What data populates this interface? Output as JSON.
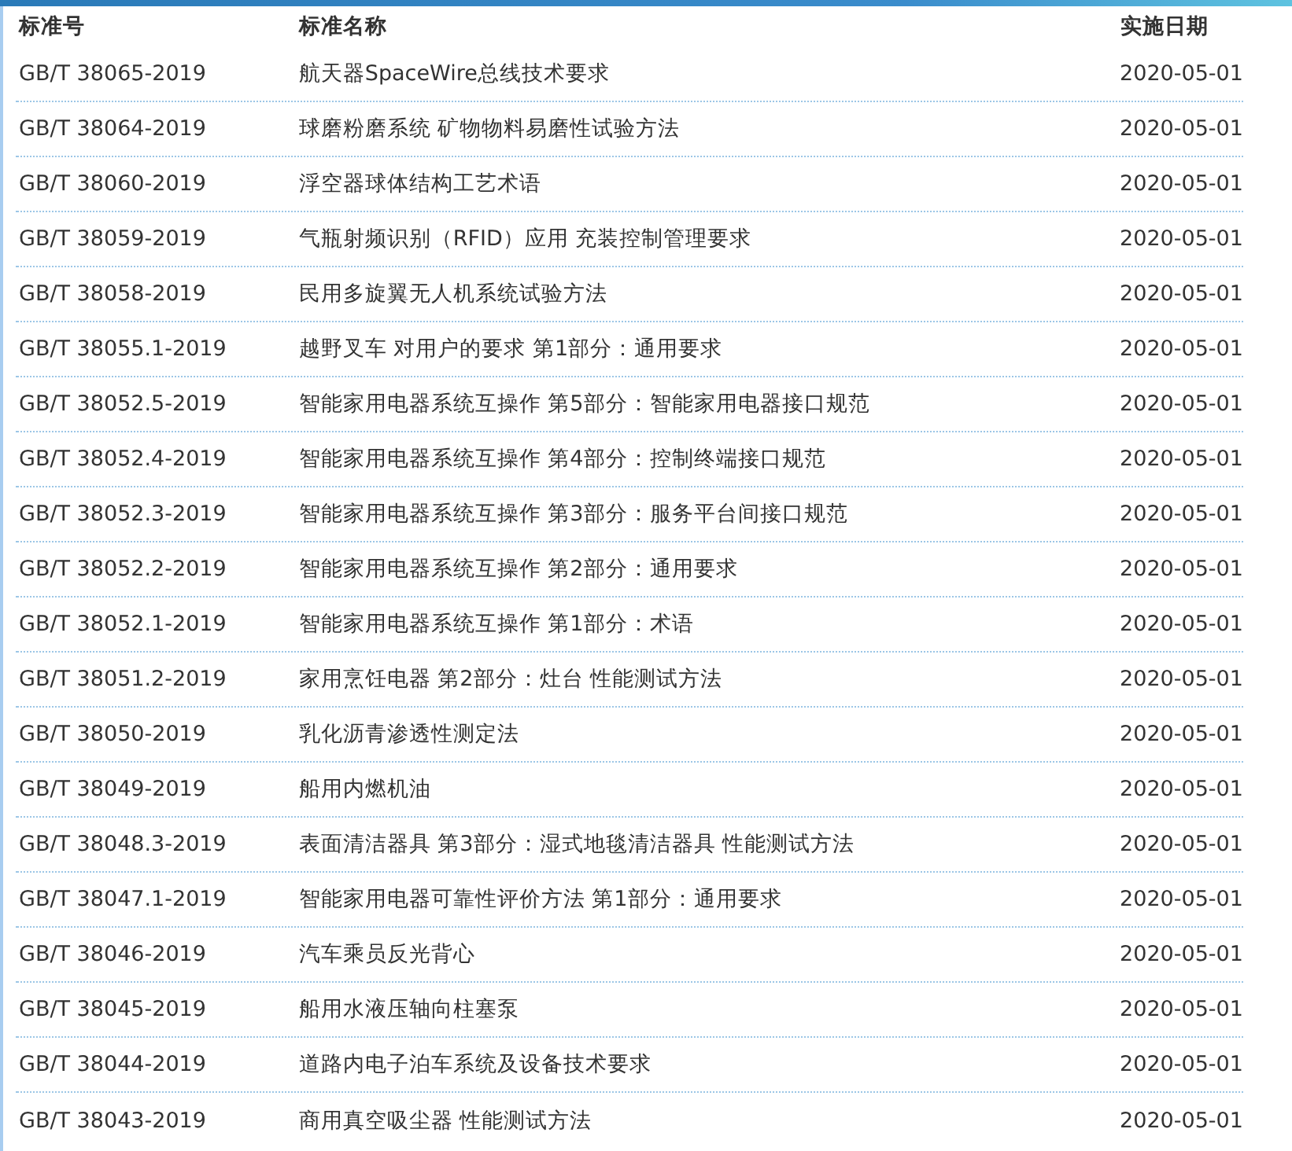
{
  "table": {
    "columns": [
      "标准号",
      "标准名称",
      "实施日期"
    ],
    "rows": [
      [
        "GB/T 38065-2019",
        "航天器SpaceWire总线技术要求",
        "2020-05-01"
      ],
      [
        "GB/T 38064-2019",
        "球磨粉磨系统 矿物物料易磨性试验方法",
        "2020-05-01"
      ],
      [
        "GB/T 38060-2019",
        "浮空器球体结构工艺术语",
        "2020-05-01"
      ],
      [
        "GB/T 38059-2019",
        "气瓶射频识别（RFID）应用 充装控制管理要求",
        "2020-05-01"
      ],
      [
        "GB/T 38058-2019",
        "民用多旋翼无人机系统试验方法",
        "2020-05-01"
      ],
      [
        "GB/T 38055.1-2019",
        "越野叉车 对用户的要求 第1部分：通用要求",
        "2020-05-01"
      ],
      [
        "GB/T 38052.5-2019",
        "智能家用电器系统互操作 第5部分：智能家用电器接口规范",
        "2020-05-01"
      ],
      [
        "GB/T 38052.4-2019",
        "智能家用电器系统互操作 第4部分：控制终端接口规范",
        "2020-05-01"
      ],
      [
        "GB/T 38052.3-2019",
        "智能家用电器系统互操作 第3部分：服务平台间接口规范",
        "2020-05-01"
      ],
      [
        "GB/T 38052.2-2019",
        "智能家用电器系统互操作 第2部分：通用要求",
        "2020-05-01"
      ],
      [
        "GB/T 38052.1-2019",
        "智能家用电器系统互操作 第1部分：术语",
        "2020-05-01"
      ],
      [
        "GB/T 38051.2-2019",
        "家用烹饪电器 第2部分：灶台 性能测试方法",
        "2020-05-01"
      ],
      [
        "GB/T 38050-2019",
        "乳化沥青渗透性测定法",
        "2020-05-01"
      ],
      [
        "GB/T 38049-2019",
        "船用内燃机油",
        "2020-05-01"
      ],
      [
        "GB/T 38048.3-2019",
        "表面清洁器具 第3部分：湿式地毯清洁器具 性能测试方法",
        "2020-05-01"
      ],
      [
        "GB/T 38047.1-2019",
        "智能家用电器可靠性评价方法 第1部分：通用要求",
        "2020-05-01"
      ],
      [
        "GB/T 38046-2019",
        "汽车乘员反光背心",
        "2020-05-01"
      ],
      [
        "GB/T 38045-2019",
        "船用水液压轴向柱塞泵",
        "2020-05-01"
      ],
      [
        "GB/T 38044-2019",
        "道路内电子泊车系统及设备技术要求",
        "2020-05-01"
      ],
      [
        "GB/T 38043-2019",
        "商用真空吸尘器 性能测试方法",
        "2020-05-01"
      ]
    ]
  }
}
